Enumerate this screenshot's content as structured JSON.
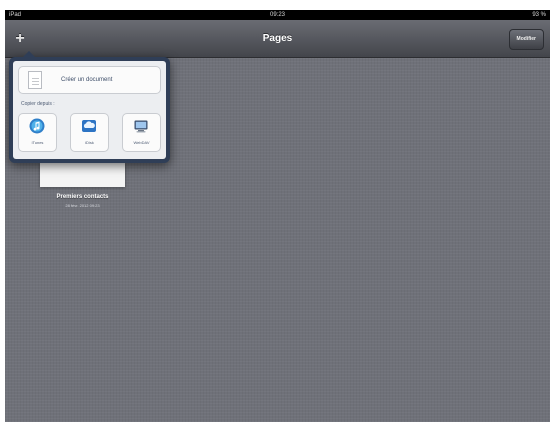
{
  "status_bar": {
    "carrier": "iPad",
    "time": "09:23",
    "battery": "93 %"
  },
  "nav": {
    "title": "Pages",
    "add_label": "+",
    "edit_label": "Modifier"
  },
  "popover": {
    "create_label": "Créer un document",
    "copy_from_label": "Copier depuis :",
    "sources": [
      {
        "label": "iTunes",
        "icon": "itunes-icon"
      },
      {
        "label": "iDisk",
        "icon": "idisk-icon"
      },
      {
        "label": "WebDAV",
        "icon": "webdav-icon"
      }
    ]
  },
  "documents": [
    {
      "title": "Premiers contacts",
      "date": "28 févr. 2012 09:23"
    }
  ],
  "colors": {
    "background": "#6f7179",
    "nav_bar": "#55575e",
    "popover_frame": "#2f3e57",
    "popover_body": "#eceef1",
    "label_text": "#3f4f6a"
  }
}
